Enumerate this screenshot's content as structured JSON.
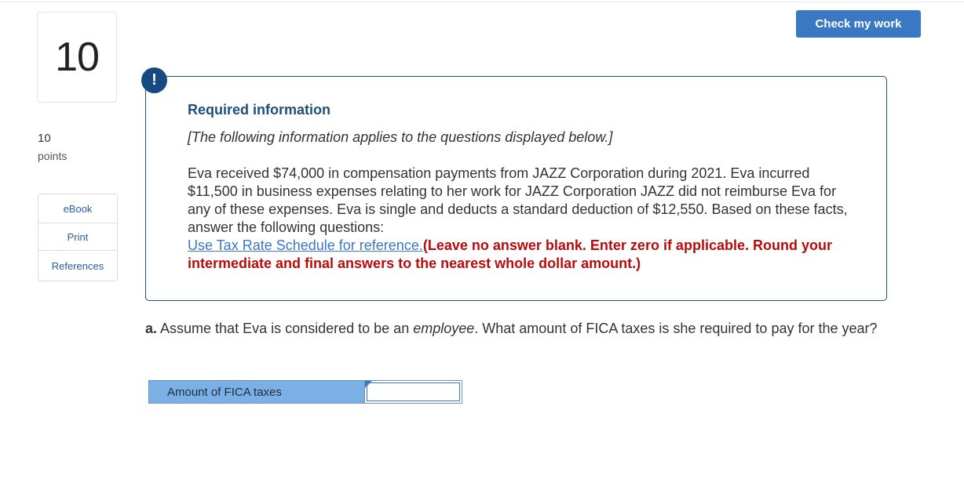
{
  "question": {
    "number": "10",
    "points_value": "10",
    "points_label": "points"
  },
  "side_tools": [
    "eBook",
    "Print",
    "References"
  ],
  "header": {
    "check_button": "Check my work"
  },
  "required_info": {
    "alert_glyph": "!",
    "title": "Required information",
    "subtitle": "[The following information applies to the questions displayed below.]",
    "body": "Eva received $74,000 in compensation payments from JAZZ Corporation during 2021. Eva incurred $11,500 in business expenses relating to her work for JAZZ Corporation JAZZ did not reimburse Eva for any of these expenses. Eva is single and deducts a standard deduction of $12,550. Based on these facts, answer the following questions:",
    "link_text": "Use Tax Rate Schedule for reference.",
    "warning": "(Leave no answer blank. Enter zero if applicable. Round your intermediate and final answers to the nearest whole dollar amount.)"
  },
  "part_a": {
    "label": "a.",
    "text_before": " Assume that Eva is considered to be an ",
    "emphasis": "employee",
    "text_after": ". What amount of FICA taxes is she required to pay for the year?"
  },
  "answer": {
    "row_label": "Amount of FICA taxes",
    "value": ""
  },
  "colors": {
    "accent": "#3a78c3",
    "title_blue": "#1f4f7a",
    "warning_red": "#b80c0c",
    "answer_label_bg": "#7ab0e6"
  }
}
